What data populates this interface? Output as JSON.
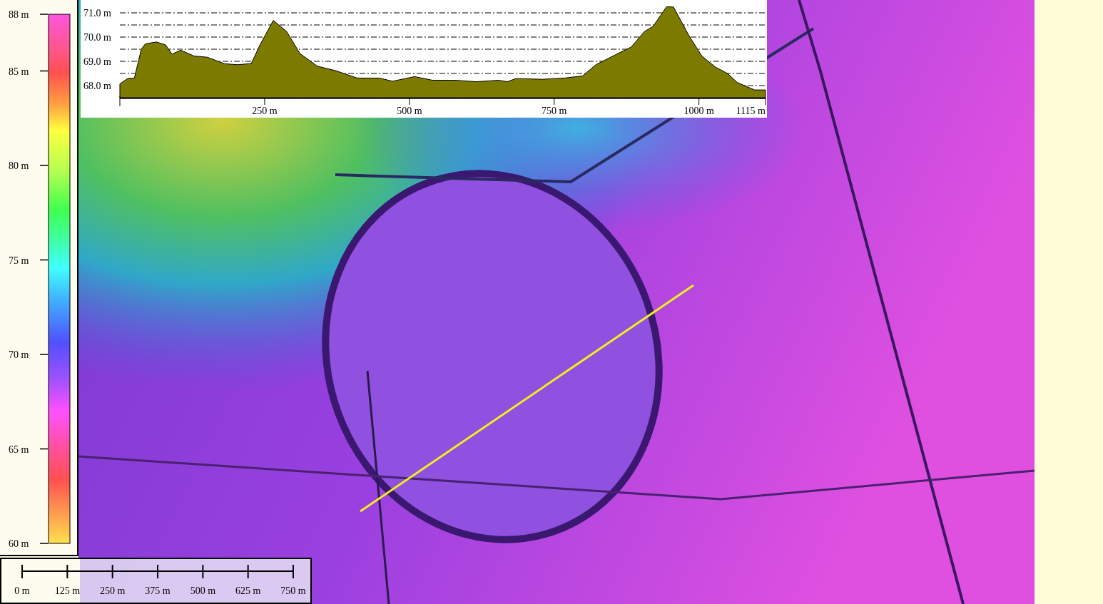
{
  "legend": {
    "labels": [
      "88 m",
      "85 m",
      "80 m",
      "75 m",
      "70 m",
      "65 m",
      "60 m"
    ]
  },
  "profile": {
    "chart_data": {
      "type": "area",
      "x": [
        0,
        14,
        25,
        37,
        44,
        63,
        79,
        90,
        105,
        128,
        151,
        181,
        204,
        227,
        242,
        265,
        288,
        311,
        341,
        372,
        410,
        448,
        471,
        509,
        540,
        578,
        616,
        654,
        669,
        684,
        730,
        768,
        799,
        822,
        860,
        883,
        906,
        921,
        944,
        956,
        983,
        1005,
        1028,
        1050,
        1066,
        1096,
        1115
      ],
      "grid": true,
      "series": [
        {
          "color": "#7d7a00",
          "values": [
            68.07,
            68.3,
            68.3,
            69.5,
            69.72,
            69.8,
            69.68,
            69.3,
            69.46,
            69.22,
            69.17,
            68.9,
            68.86,
            68.91,
            69.68,
            70.69,
            70.23,
            69.32,
            68.8,
            68.62,
            68.31,
            68.31,
            68.18,
            68.37,
            68.22,
            68.22,
            68.16,
            68.22,
            68.16,
            68.29,
            68.26,
            68.31,
            68.4,
            68.86,
            69.32,
            69.59,
            70.23,
            70.45,
            71.25,
            71.24,
            70.05,
            69.22,
            68.77,
            68.49,
            68.13,
            67.82,
            67.82
          ]
        }
      ],
      "xlim": [
        0,
        1115
      ],
      "ylim": [
        67.5,
        71.5
      ],
      "xticks": [
        {
          "value": 250,
          "label": "250 m"
        },
        {
          "value": 500,
          "label": "500 m"
        },
        {
          "value": 750,
          "label": "750 m"
        },
        {
          "value": 1000,
          "label": "1000 m"
        },
        {
          "value": 1115,
          "label": "1115 m"
        }
      ],
      "yticks": [
        {
          "value": 68,
          "label": "68.0 m"
        },
        {
          "value": 69,
          "label": "69.0 m"
        },
        {
          "value": 70,
          "label": "70.0 m"
        },
        {
          "value": 71,
          "label": "71.0 m"
        }
      ]
    }
  },
  "scale_bar": {
    "labels": [
      "0 m",
      "125 m",
      "250 m",
      "375 m",
      "500 m",
      "625 m",
      "750 m"
    ]
  }
}
